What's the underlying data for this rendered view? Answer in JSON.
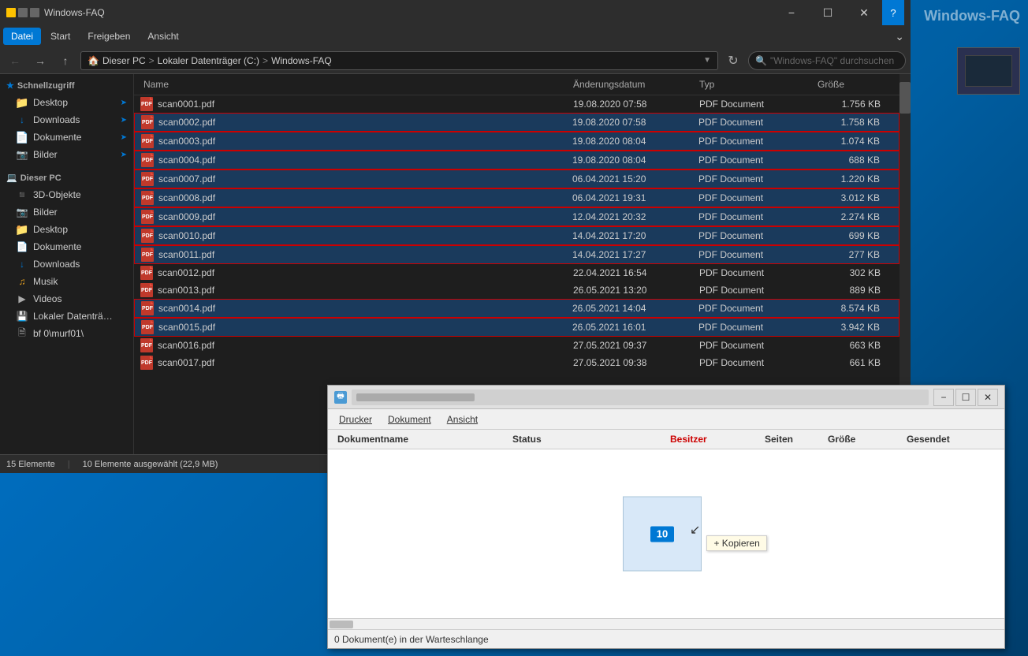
{
  "bg_label": "Windows-FAQ",
  "explorer": {
    "title": "Windows-FAQ",
    "menu_items": [
      "Datei",
      "Start",
      "Freigeben",
      "Ansicht"
    ],
    "address": {
      "back": "←",
      "forward": "→",
      "up": "↑",
      "home_icon": "🏠",
      "path": [
        "Dieser PC",
        "Lokaler Datenträger (C:)",
        "Windows-FAQ"
      ],
      "search_placeholder": "\"Windows-FAQ\" durchsuchen"
    },
    "sidebar": {
      "quick_access_label": "Schnellzugriff",
      "items": [
        {
          "label": "Desktop",
          "pinned": true
        },
        {
          "label": "Downloads",
          "pinned": true
        },
        {
          "label": "Dokumente",
          "pinned": true
        },
        {
          "label": "Bilder",
          "pinned": true
        }
      ],
      "this_pc_label": "Dieser PC",
      "pc_items": [
        {
          "label": "3D-Objekte"
        },
        {
          "label": "Bilder"
        },
        {
          "label": "Desktop"
        },
        {
          "label": "Dokumente"
        },
        {
          "label": "Downloads"
        },
        {
          "label": "Musik"
        },
        {
          "label": "Videos"
        },
        {
          "label": "Lokaler Datenträ…"
        },
        {
          "label": "bf 0\\murf01\\"
        }
      ]
    },
    "file_list": {
      "headers": [
        "Name",
        "Änderungsdatum",
        "Typ",
        "Größe"
      ],
      "files": [
        {
          "name": "scan0001.pdf",
          "date": "19.08.2020 07:58",
          "type": "PDF Document",
          "size": "1.756 KB",
          "selected": false,
          "highlighted": false
        },
        {
          "name": "scan0002.pdf",
          "date": "19.08.2020 07:58",
          "type": "PDF Document",
          "size": "1.758 KB",
          "selected": true,
          "highlighted": true
        },
        {
          "name": "scan0003.pdf",
          "date": "19.08.2020 08:04",
          "type": "PDF Document",
          "size": "1.074 KB",
          "selected": true,
          "highlighted": true
        },
        {
          "name": "scan0004.pdf",
          "date": "19.08.2020 08:04",
          "type": "PDF Document",
          "size": "688 KB",
          "selected": true,
          "highlighted": true
        },
        {
          "name": "scan0007.pdf",
          "date": "06.04.2021 15:20",
          "type": "PDF Document",
          "size": "1.220 KB",
          "selected": true,
          "highlighted": true
        },
        {
          "name": "scan0008.pdf",
          "date": "06.04.2021 19:31",
          "type": "PDF Document",
          "size": "3.012 KB",
          "selected": true,
          "highlighted": true
        },
        {
          "name": "scan0009.pdf",
          "date": "12.04.2021 20:32",
          "type": "PDF Document",
          "size": "2.274 KB",
          "selected": true,
          "highlighted": true
        },
        {
          "name": "scan0010.pdf",
          "date": "14.04.2021 17:20",
          "type": "PDF Document",
          "size": "699 KB",
          "selected": true,
          "highlighted": true
        },
        {
          "name": "scan0011.pdf",
          "date": "14.04.2021 17:27",
          "type": "PDF Document",
          "size": "277 KB",
          "selected": true,
          "highlighted": true
        },
        {
          "name": "scan0012.pdf",
          "date": "22.04.2021 16:54",
          "type": "PDF Document",
          "size": "302 KB",
          "selected": false,
          "highlighted": false
        },
        {
          "name": "scan0013.pdf",
          "date": "26.05.2021 13:20",
          "type": "PDF Document",
          "size": "889 KB",
          "selected": false,
          "highlighted": false
        },
        {
          "name": "scan0014.pdf",
          "date": "26.05.2021 14:04",
          "type": "PDF Document",
          "size": "8.574 KB",
          "selected": true,
          "highlighted": true
        },
        {
          "name": "scan0015.pdf",
          "date": "26.05.2021 16:01",
          "type": "PDF Document",
          "size": "3.942 KB",
          "selected": true,
          "highlighted": true
        },
        {
          "name": "scan0016.pdf",
          "date": "27.05.2021 09:37",
          "type": "PDF Document",
          "size": "663 KB",
          "selected": false,
          "highlighted": false
        },
        {
          "name": "scan0017.pdf",
          "date": "27.05.2021 09:38",
          "type": "PDF Document",
          "size": "661 KB",
          "selected": false,
          "highlighted": false
        }
      ]
    },
    "status": {
      "total": "15 Elemente",
      "selected": "10 Elemente ausgewählt (22,9 MB)"
    }
  },
  "printer_window": {
    "title_placeholder": "████████████████████",
    "menu_items": [
      "Drucker",
      "Dokument",
      "Ansicht"
    ],
    "list_headers": [
      "Dokumentname",
      "Status",
      "Besitzer",
      "Seiten",
      "Größe",
      "Gesendet"
    ],
    "drag_badge": "10",
    "copy_tooltip": "+ Kopieren",
    "status_bar": "0 Dokument(e) in der Warteschlange"
  }
}
